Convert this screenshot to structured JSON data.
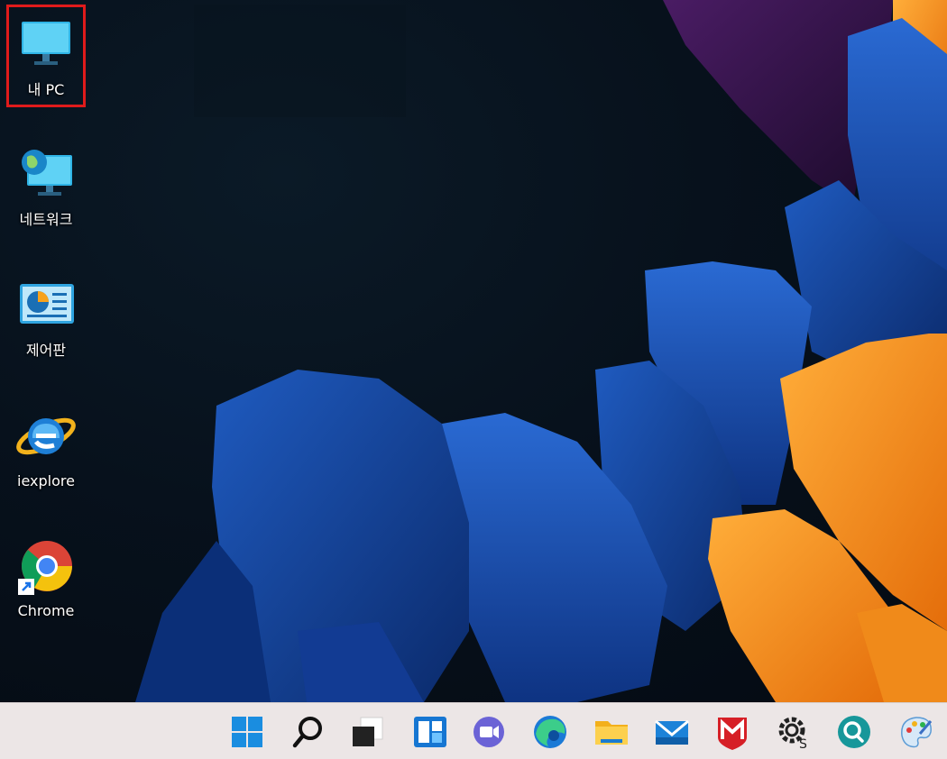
{
  "desktop": {
    "icons": [
      {
        "label": "내 PC",
        "icon": "monitor-icon",
        "selected": true
      },
      {
        "label": "네트워크",
        "icon": "network-globe-icon",
        "selected": false
      },
      {
        "label": "제어판",
        "icon": "control-panel-icon",
        "selected": false
      },
      {
        "label": "iexplore",
        "icon": "internet-explorer-icon",
        "selected": false
      },
      {
        "label": "Chrome",
        "icon": "chrome-shortcut-icon",
        "selected": false
      }
    ]
  },
  "taskbar": {
    "items": [
      {
        "icon": "windows-start-icon"
      },
      {
        "icon": "search-icon"
      },
      {
        "icon": "task-view-icon"
      },
      {
        "icon": "widgets-icon"
      },
      {
        "icon": "teams-chat-icon"
      },
      {
        "icon": "edge-icon"
      },
      {
        "icon": "file-explorer-icon"
      },
      {
        "icon": "mail-icon"
      },
      {
        "icon": "mcafee-icon"
      },
      {
        "icon": "settings-icon"
      },
      {
        "icon": "quick-assist-icon"
      },
      {
        "icon": "paint-icon"
      }
    ]
  },
  "colors": {
    "selection_border": "#e01b1b",
    "taskbar_bg": "#ece6e6",
    "wallpaper_blue": "#1c4fa8",
    "wallpaper_orange": "#f7931e",
    "wallpaper_purple": "#3a1650"
  }
}
